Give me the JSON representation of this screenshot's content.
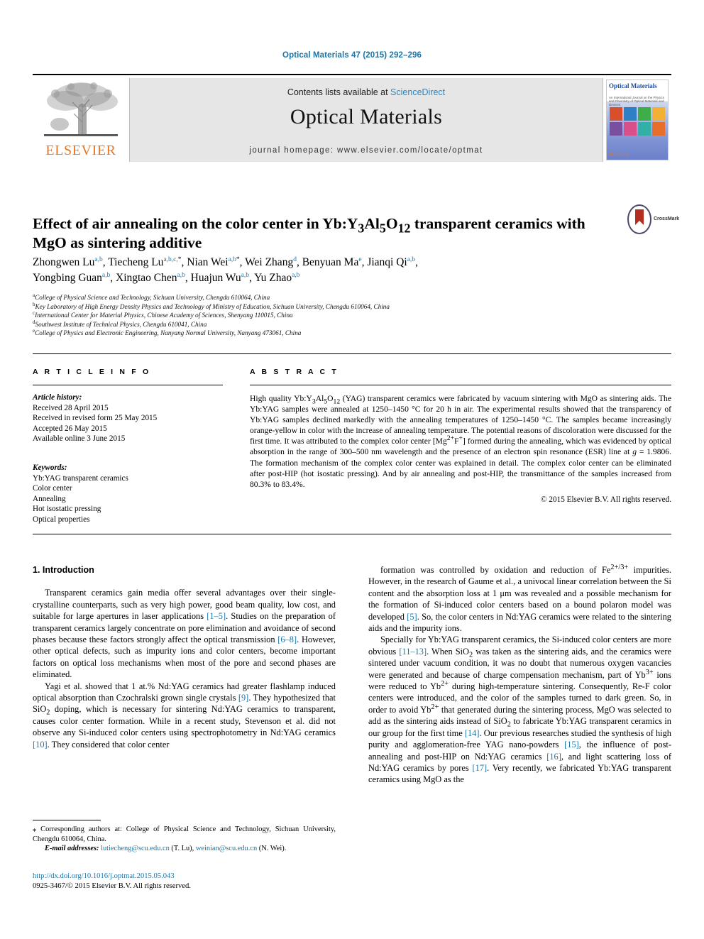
{
  "running_head": "Optical Materials 47 (2015) 292–296",
  "masthead": {
    "contents_prefix": "Contents lists available at ",
    "sciencedirect": "ScienceDirect",
    "journal_name": "Optical Materials",
    "homepage": "journal homepage: www.elsevier.com/locate/optmat",
    "publisher": "ELSEVIER",
    "publisher_logo": "elsevier-tree-logo",
    "cover": {
      "title": "Optical Materials",
      "subtitle": "An International Journal on the Physics and Chemistry of Optical Materials and Devices",
      "publisher": "ELSEVIER",
      "swatches": [
        "#d94f2b",
        "#2f7fc4",
        "#3fae49",
        "#f2b134",
        "#7b4fa0",
        "#d94f8a",
        "#31b0a8",
        "#e86f2b"
      ]
    }
  },
  "article": {
    "title_part1": "Effect of air annealing on the color center in Yb:Y",
    "title_sub1": "3",
    "title_part2": "Al",
    "title_sub2": "5",
    "title_part3": "O",
    "title_sub3": "12",
    "title_part4": " transparent ceramics with MgO as sintering additive",
    "crossmark_label": "CrossMark"
  },
  "authors": [
    {
      "name": "Zhongwen Lu",
      "marks": "a,b",
      "star": ""
    },
    {
      "name": "Tiecheng Lu",
      "marks": "a,b,c,",
      "star": "*"
    },
    {
      "name": "Nian Wei",
      "marks": "a,b",
      "star": "*"
    },
    {
      "name": "Wei Zhang",
      "marks": "d",
      "star": ""
    },
    {
      "name": "Benyuan Ma",
      "marks": "e",
      "star": ""
    },
    {
      "name": "Jianqi Qi",
      "marks": "a,b",
      "star": ""
    },
    {
      "name": "Yongbing Guan",
      "marks": "a,b",
      "star": ""
    },
    {
      "name": "Xingtao Chen",
      "marks": "a,b",
      "star": ""
    },
    {
      "name": "Huajun Wu",
      "marks": "a,b",
      "star": ""
    },
    {
      "name": "Yu Zhao",
      "marks": "a,b",
      "star": ""
    }
  ],
  "affiliations": [
    {
      "mark": "a",
      "text": "College of Physical Science and Technology, Sichuan University, Chengdu 610064, China"
    },
    {
      "mark": "b",
      "text": "Key Laboratory of High Energy Density Physics and Technology of Ministry of Education, Sichuan University, Chengdu 610064, China"
    },
    {
      "mark": "c",
      "text": "International Center for Material Physics, Chinese Academy of Sciences, Shenyang 110015, China"
    },
    {
      "mark": "d",
      "text": "Southwest Institute of Technical Physics, Chengdu 610041, China"
    },
    {
      "mark": "e",
      "text": "College of Physics and Electronic Engineering, Nanyang Normal University, Nanyang 473061, China"
    }
  ],
  "article_info": {
    "heading": "A R T I C L E   I N F O",
    "history_label": "Article history:",
    "history": [
      "Received 28 April 2015",
      "Received in revised form 25 May 2015",
      "Accepted 26 May 2015",
      "Available online 3 June 2015"
    ],
    "keywords_label": "Keywords:",
    "keywords": [
      "Yb:YAG transparent ceramics",
      "Color center",
      "Annealing",
      "Hot isostatic pressing",
      "Optical properties"
    ]
  },
  "abstract": {
    "heading": "A B S T R A C T",
    "text": "High quality Yb:Y3Al5O12 (YAG) transparent ceramics were fabricated by vacuum sintering with MgO as sintering aids. The Yb:YAG samples were annealed at 1250–1450 °C for 20 h in air. The experimental results showed that the transparency of Yb:YAG samples declined markedly with the annealing temperatures of 1250–1450 °C. The samples became increasingly orange-yellow in color with the increase of annealing temperature. The potential reasons of discoloration were discussed for the first time. It was attributed to the complex color center [Mg2+F+] formed during the annealing, which was evidenced by optical absorption in the range of 300–500 nm wavelength and the presence of an electron spin resonance (ESR) line at g = 1.9806. The formation mechanism of the complex color center was explained in detail. The complex color center can be eliminated after post-HIP (hot isostatic pressing). And by air annealing and post-HIP, the transmittance of the samples increased from 80.3% to 83.4%.",
    "copyright": "© 2015 Elsevier B.V. All rights reserved."
  },
  "body": {
    "section_heading": "1. Introduction",
    "left_paragraphs": [
      "Transparent ceramics gain media offer several advantages over their single-crystalline counterparts, such as very high power, good beam quality, low cost, and suitable for large apertures in laser applications [1–5]. Studies on the preparation of transparent ceramics largely concentrate on pore elimination and avoidance of second phases because these factors strongly affect the optical transmission [6–8]. However, other optical defects, such as impurity ions and color centers, become important factors on optical loss mechanisms when most of the pore and second phases are eliminated.",
      "Yagi et al. showed that 1 at.% Nd:YAG ceramics had greater flashlamp induced optical absorption than Czochralski grown single crystals [9]. They hypothesized that SiO2 doping, which is necessary for sintering Nd:YAG ceramics to transparent, causes color center formation. While in a recent study, Stevenson et al. did not observe any Si-induced color centers using spectrophotometry in Nd:YAG ceramics [10]. They considered that color center"
    ],
    "right_paragraphs": [
      "formation was controlled by oxidation and reduction of Fe2+/3+ impurities. However, in the research of Gaume et al., a univocal linear correlation between the Si content and the absorption loss at 1 μm was revealed and a possible mechanism for the formation of Si-induced color centers based on a bound polaron model was developed [5]. So, the color centers in Nd:YAG ceramics were related to the sintering aids and the impurity ions.",
      "Specially for Yb:YAG transparent ceramics, the Si-induced color centers are more obvious [11–13]. When SiO2 was taken as the sintering aids, and the ceramics were sintered under vacuum condition, it was no doubt that numerous oxygen vacancies were generated and because of charge compensation mechanism, part of Yb3+ ions were reduced to Yb2+ during high-temperature sintering. Consequently, Re-F color centers were introduced, and the color of the samples turned to dark green. So, in order to avoid Yb2+ that generated during the sintering process, MgO was selected to add as the sintering aids instead of SiO2 to fabricate Yb:YAG transparent ceramics in our group for the first time [14]. Our previous researches studied the synthesis of high purity and agglomeration-free YAG nano-powders [15], the influence of post-annealing and post-HIP on Nd:YAG ceramics [16], and light scattering loss of Nd:YAG ceramics by pores [17]. Very recently, we fabricated Yb:YAG transparent ceramics using MgO as the"
    ]
  },
  "footnotes": {
    "corresponding": "⁎ Corresponding authors at: College of Physical Science and Technology, Sichuan University, Chengdu 610064, China.",
    "email_label": "E-mail addresses:",
    "emails": [
      {
        "address": "lutiecheng@scu.edu.cn",
        "person": "(T. Lu)"
      },
      {
        "address": "weinian@scu.edu.cn",
        "person": "(N. Wei)"
      }
    ],
    "doi": "http://dx.doi.org/10.1016/j.optmat.2015.05.043",
    "issn_line": "0925-3467/© 2015 Elsevier B.V. All rights reserved."
  },
  "colors": {
    "link_blue": "#1a75a7",
    "sciencedirect_blue": "#2b87c4",
    "elsevier_orange": "#e87722",
    "masthead_grey": "#e6e6e6"
  }
}
